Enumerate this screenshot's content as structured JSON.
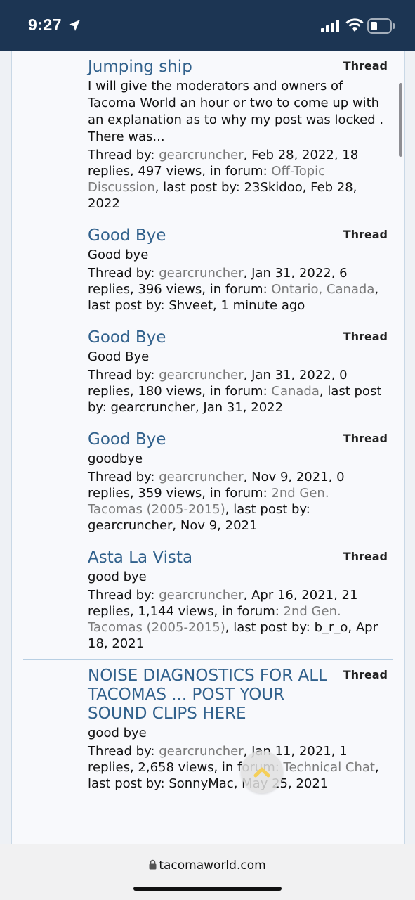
{
  "status_bar": {
    "time": "9:27"
  },
  "browser": {
    "url": "tacomaworld.com"
  },
  "results": [
    {
      "title": "Jumping ship",
      "type": "Thread",
      "snippet": "I will give the moderators and owners of Tacoma World an hour or two to come up with an explanation as to why my post was locked . There was...",
      "meta_prefix": "Thread by: ",
      "author": "gearcruncher",
      "meta_mid": ", Feb 28, 2022, 18 replies, 497 views, in forum: ",
      "forum": "Off-Topic Discussion",
      "meta_suffix": ", last post by: 23Skidoo, Feb 28, 2022"
    },
    {
      "title": "Good Bye",
      "type": "Thread",
      "snippet": "Good bye",
      "meta_prefix": "Thread by: ",
      "author": "gearcruncher",
      "meta_mid": ", Jan 31, 2022, 6 replies, 396 views, in forum: ",
      "forum": "Ontario, Canada",
      "meta_suffix": ", last post by: Shveet, 1 minute ago"
    },
    {
      "title": "Good Bye",
      "type": "Thread",
      "snippet": "Good Bye",
      "meta_prefix": "Thread by: ",
      "author": "gearcruncher",
      "meta_mid": ", Jan 31, 2022, 0 replies, 180 views, in forum: ",
      "forum": "Canada",
      "meta_suffix": ", last post by: gearcruncher, Jan 31, 2022"
    },
    {
      "title": "Good Bye",
      "type": "Thread",
      "snippet": "goodbye",
      "meta_prefix": "Thread by: ",
      "author": "gearcruncher",
      "meta_mid": ", Nov 9, 2021, 0 replies, 359 views, in forum: ",
      "forum": "2nd Gen. Tacomas (2005-2015)",
      "meta_suffix": ", last post by: gearcruncher, Nov 9, 2021"
    },
    {
      "title": "Asta La Vista",
      "type": "Thread",
      "snippet": "good bye",
      "meta_prefix": "Thread by: ",
      "author": "gearcruncher",
      "meta_mid": ", Apr 16, 2021, 21 replies, 1,144 views, in forum: ",
      "forum": "2nd Gen. Tacomas (2005-2015)",
      "meta_suffix": ", last post by: b_r_o, Apr 18, 2021"
    },
    {
      "title": "NOISE DIAGNOSTICS FOR ALL TACOMAS ... POST YOUR SOUND CLIPS HERE",
      "type": "Thread",
      "snippet": "good bye",
      "meta_prefix": "Thread by: ",
      "author": "gearcruncher",
      "meta_mid": ", Jan 11, 2021, 1 replies, 2,658 views, in forum: ",
      "forum": "Technical Chat",
      "meta_suffix": ", last post by: SonnyMac, May 25, 2021"
    }
  ],
  "colors": {
    "status_bar": "#1c3553",
    "link_title": "#31618c",
    "link_muted": "#7a7a7a",
    "divider": "#b8cfe3"
  },
  "icons": [
    "location-arrow-icon",
    "signal-icon",
    "wifi-icon",
    "battery-icon",
    "chevron-up-icon",
    "lock-icon"
  ]
}
